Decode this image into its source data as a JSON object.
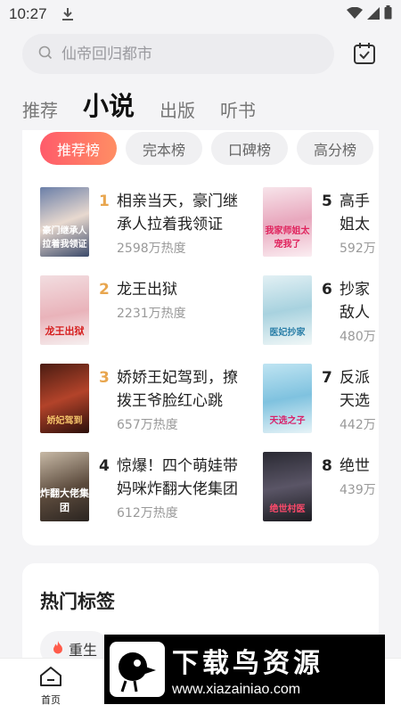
{
  "status_bar": {
    "time": "10:27"
  },
  "search": {
    "placeholder": "仙帝回归都市"
  },
  "tabs": [
    {
      "label": "推荐",
      "active": false
    },
    {
      "label": "小说",
      "active": true
    },
    {
      "label": "出版",
      "active": false
    },
    {
      "label": "听书",
      "active": false
    }
  ],
  "chips": [
    {
      "label": "推荐榜",
      "active": true
    },
    {
      "label": "完本榜",
      "active": false
    },
    {
      "label": "口碑榜",
      "active": false
    },
    {
      "label": "高分榜",
      "active": false
    }
  ],
  "books": [
    {
      "rank": "1",
      "title": "相亲当天，豪门继承人拉着我领证",
      "heat": "2598万热度",
      "cover_text": "豪门继承人拉着我领证"
    },
    {
      "rank": "2",
      "title": "龙王出狱",
      "heat": "2231万热度",
      "cover_text": "龙王出狱"
    },
    {
      "rank": "3",
      "title": "娇娇王妃驾到，撩拨王爷脸红心跳",
      "heat": "657万热度",
      "cover_text": "娇妃驾到"
    },
    {
      "rank": "4",
      "title": "惊爆！四个萌娃带妈咪炸翻大佬集团",
      "heat": "612万热度",
      "cover_text": "炸翻大佬集团"
    },
    {
      "rank": "5",
      "title": "高手姐太",
      "heat": "592万",
      "cover_text": "我家师姐太宠我了"
    },
    {
      "rank": "6",
      "title": "抄家敌人",
      "heat": "480万",
      "cover_text": "医妃抄家"
    },
    {
      "rank": "7",
      "title": "反派天选",
      "heat": "442万",
      "cover_text": "天选之子"
    },
    {
      "rank": "8",
      "title": "绝世",
      "heat": "439万",
      "cover_text": "绝世村医"
    }
  ],
  "hot_tags": {
    "title": "热门标签",
    "items": [
      {
        "label": "重生"
      }
    ]
  },
  "bottom_nav": {
    "home_label": "首页"
  },
  "watermark": {
    "name": "下载鸟资源",
    "url": "www.xiazainiao.com"
  },
  "colors": {
    "accent_start": "#ff5b6a",
    "accent_end": "#ff8e64",
    "rank_gold": "#e8a64f"
  }
}
